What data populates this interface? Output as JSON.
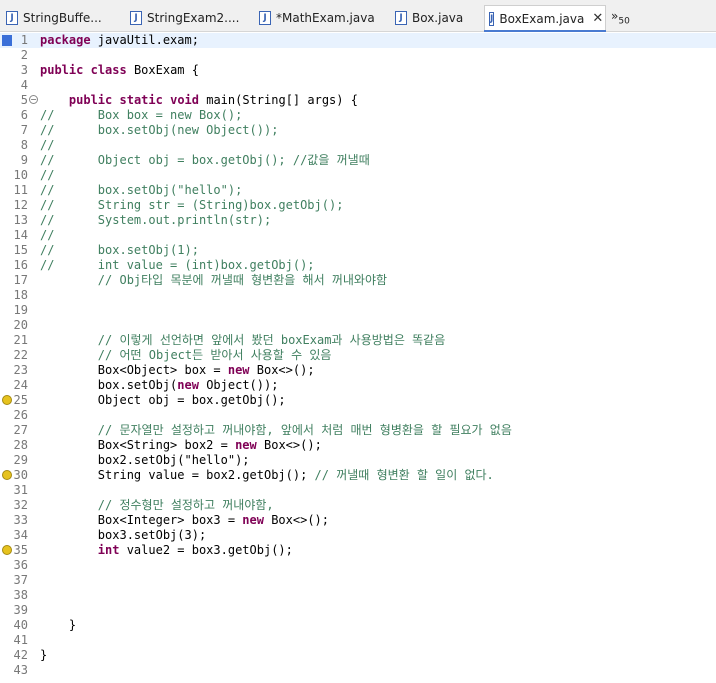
{
  "tabs": [
    {
      "label": "StringBuffe...",
      "active": false
    },
    {
      "label": "StringExam2....",
      "active": false
    },
    {
      "label": "*MathExam.java",
      "active": false
    },
    {
      "label": "Box.java",
      "active": false
    },
    {
      "label": "BoxExam.java",
      "active": true
    }
  ],
  "overflow": {
    "symbol": "»",
    "count": "50"
  },
  "lines": [
    {
      "n": "1",
      "text": "package javaUtil.exam;"
    },
    {
      "n": "2",
      "text": ""
    },
    {
      "n": "3",
      "text": "public class BoxExam {"
    },
    {
      "n": "4",
      "text": ""
    },
    {
      "n": "5",
      "text": "    public static void main(String[] args) {"
    },
    {
      "n": "6",
      "text": "//      Box box = new Box();"
    },
    {
      "n": "7",
      "text": "//      box.setObj(new Object());"
    },
    {
      "n": "8",
      "text": "//"
    },
    {
      "n": "9",
      "text": "//      Object obj = box.getObj(); //값을 꺼낼때"
    },
    {
      "n": "10",
      "text": "//"
    },
    {
      "n": "11",
      "text": "//      box.setObj(\"hello\");"
    },
    {
      "n": "12",
      "text": "//      String str = (String)box.getObj();"
    },
    {
      "n": "13",
      "text": "//      System.out.println(str);"
    },
    {
      "n": "14",
      "text": "//"
    },
    {
      "n": "15",
      "text": "//      box.setObj(1);"
    },
    {
      "n": "16",
      "text": "//      int value = (int)box.getObj();"
    },
    {
      "n": "17",
      "text": "        // Obj타입 목분에 꺼낼때 형변환을 해서 꺼내와야함"
    },
    {
      "n": "18",
      "text": ""
    },
    {
      "n": "19",
      "text": ""
    },
    {
      "n": "20",
      "text": ""
    },
    {
      "n": "21",
      "text": "        // 이렇게 선언하면 앞에서 봤던 boxExam과 사용방법은 똑같음"
    },
    {
      "n": "22",
      "text": "        // 어떤 Object든 받아서 사용할 수 있음"
    },
    {
      "n": "23",
      "text": "        Box<Object> box = new Box<>();"
    },
    {
      "n": "24",
      "text": "        box.setObj(new Object());"
    },
    {
      "n": "25",
      "text": "        Object obj = box.getObj();"
    },
    {
      "n": "26",
      "text": ""
    },
    {
      "n": "27",
      "text": "        // 문자열만 설정하고 꺼내야함, 앞에서 처럼 매번 형병환을 할 필요가 없음"
    },
    {
      "n": "28",
      "text": "        Box<String> box2 = new Box<>();"
    },
    {
      "n": "29",
      "text": "        box2.setObj(\"hello\");"
    },
    {
      "n": "30",
      "text": "        String value = box2.getObj(); // 꺼낼때 형변환 할 일이 없다."
    },
    {
      "n": "31",
      "text": ""
    },
    {
      "n": "32",
      "text": "        // 정수형만 설정하고 꺼내야함,"
    },
    {
      "n": "33",
      "text": "        Box<Integer> box3 = new Box<>();"
    },
    {
      "n": "34",
      "text": "        box3.setObj(3);"
    },
    {
      "n": "35",
      "text": "        int value2 = box3.getObj();"
    },
    {
      "n": "36",
      "text": ""
    },
    {
      "n": "37",
      "text": ""
    },
    {
      "n": "38",
      "text": ""
    },
    {
      "n": "39",
      "text": ""
    },
    {
      "n": "40",
      "text": "    }"
    },
    {
      "n": "41",
      "text": ""
    },
    {
      "n": "42",
      "text": "}"
    },
    {
      "n": "43",
      "text": ""
    }
  ]
}
